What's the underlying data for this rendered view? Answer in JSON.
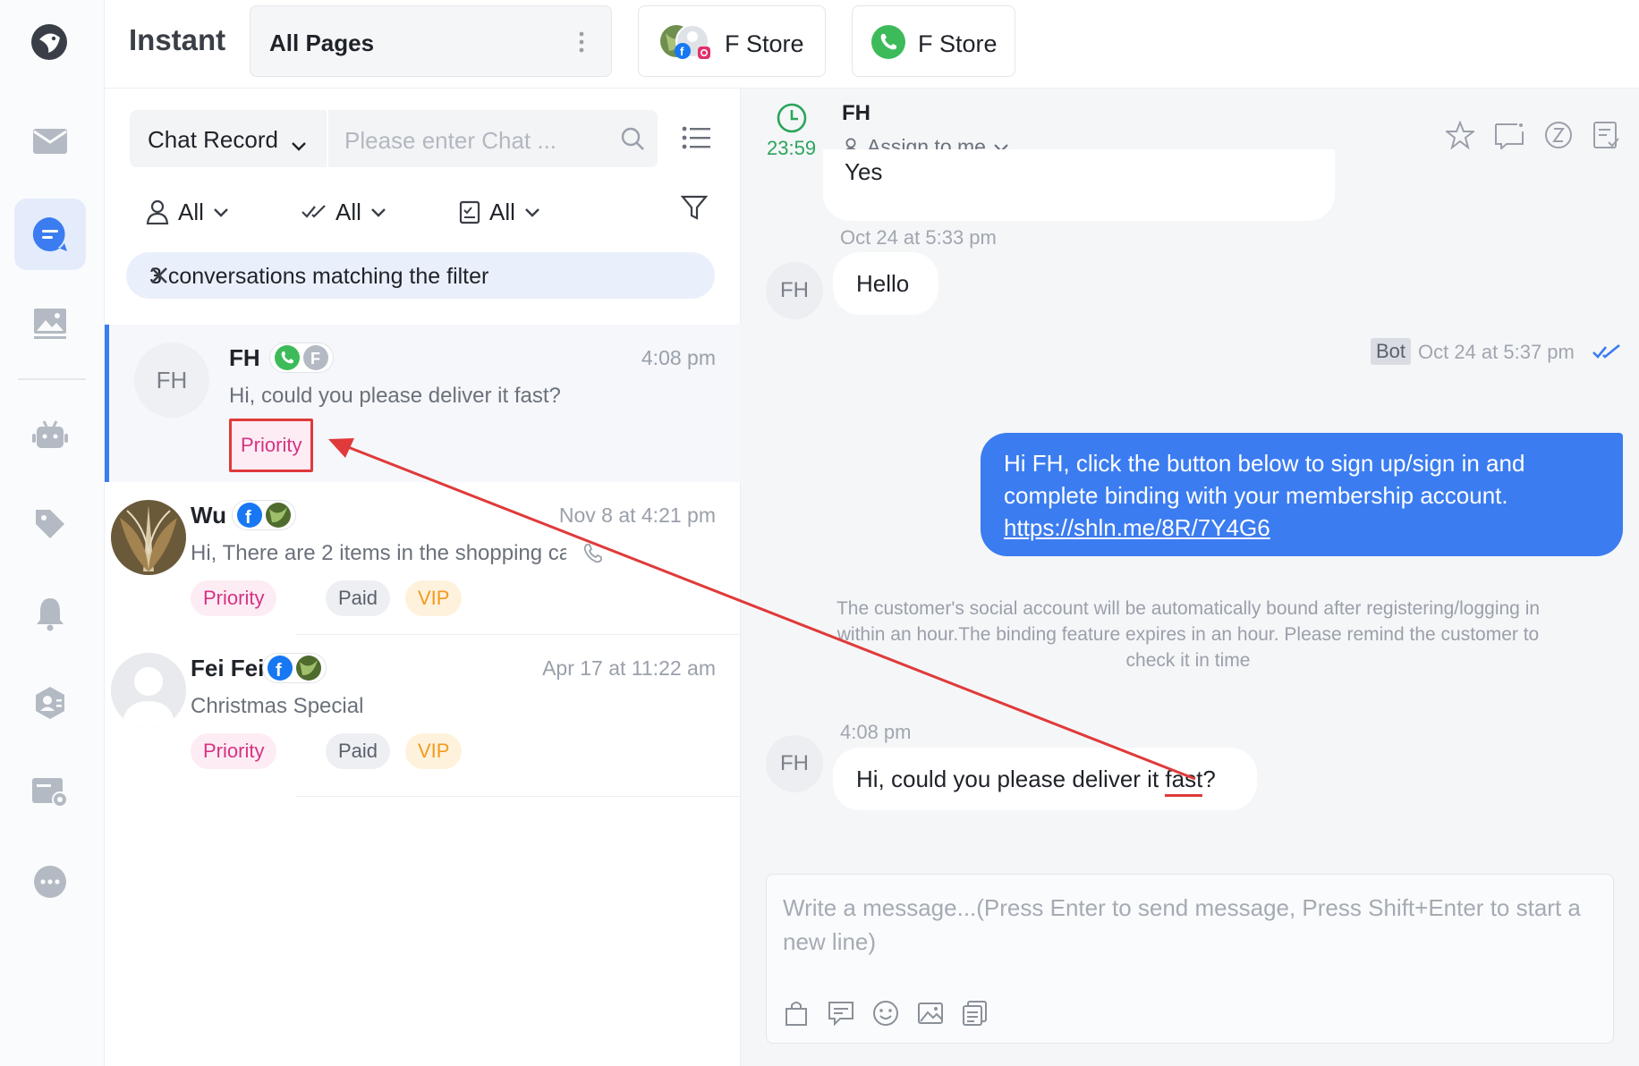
{
  "app": {
    "title": "Instant"
  },
  "pages_select": {
    "label": "All Pages"
  },
  "store_tabs": [
    {
      "label": "F Store"
    },
    {
      "label": "F Store"
    }
  ],
  "rail_icons": [
    "logo-icon",
    "mail-icon",
    "chat-icon",
    "gallery-icon",
    "bot-icon",
    "tag-icon",
    "bell-icon",
    "contacts-icon",
    "ticket-settings-icon",
    "more-icon"
  ],
  "search": {
    "type_label": "Chat Record",
    "placeholder": "Please enter Chat ..."
  },
  "filters": [
    {
      "label": "All"
    },
    {
      "label": "All"
    },
    {
      "label": "All"
    }
  ],
  "filter_banner": {
    "text": "3 conversations matching the filter"
  },
  "conversations": [
    {
      "initials": "FH",
      "name": "FH",
      "time": "4:08 pm",
      "preview": "Hi, could you please deliver it fast?",
      "tags": [
        "Priority"
      ]
    },
    {
      "name": "Wu",
      "time": "Nov 8 at 4:21 pm",
      "preview": "Hi,  There are 2 items in the shopping ca...",
      "tags": [
        "Priority",
        "Paid",
        "VIP"
      ]
    },
    {
      "name": "Fei Fei",
      "time": "Apr 17 at 11:22 am",
      "preview": "Christmas Special",
      "tags": [
        "Priority",
        "Paid",
        "VIP"
      ]
    }
  ],
  "chat": {
    "timer": "23:59",
    "name": "FH",
    "assign_label": "Assign to me",
    "messages": {
      "prev_reply": "Yes",
      "hello_time": "Oct 24 at 5:33 pm",
      "hello_avatar": "FH",
      "hello": "Hello",
      "bot_badge": "Bot",
      "bot_time": "Oct 24 at 5:37 pm",
      "bot_text": "Hi FH, click the button below to sign up/sign in and complete binding with your membership account.",
      "bot_link": "https://shln.me/8R/7Y4G6",
      "system_note": "The customer's social account will be automatically bound after registering/logging in within an hour.The binding feature expires in an hour. Please remind the customer to check it in time",
      "last_time": "4:08 pm",
      "last_avatar": "FH",
      "last_text_pre": "Hi, could you please deliver it ",
      "last_text_hl": "fast",
      "last_text_post": "?"
    },
    "composer_placeholder": "Write a message...(Press Enter to send message, Press Shift+Enter to start a new line)"
  },
  "colors": {
    "accent": "#3b7cf0",
    "priority": "#d63384",
    "annotation": "#e03a3a",
    "whatsapp": "#3dbb5a",
    "facebook": "#1877f2"
  }
}
